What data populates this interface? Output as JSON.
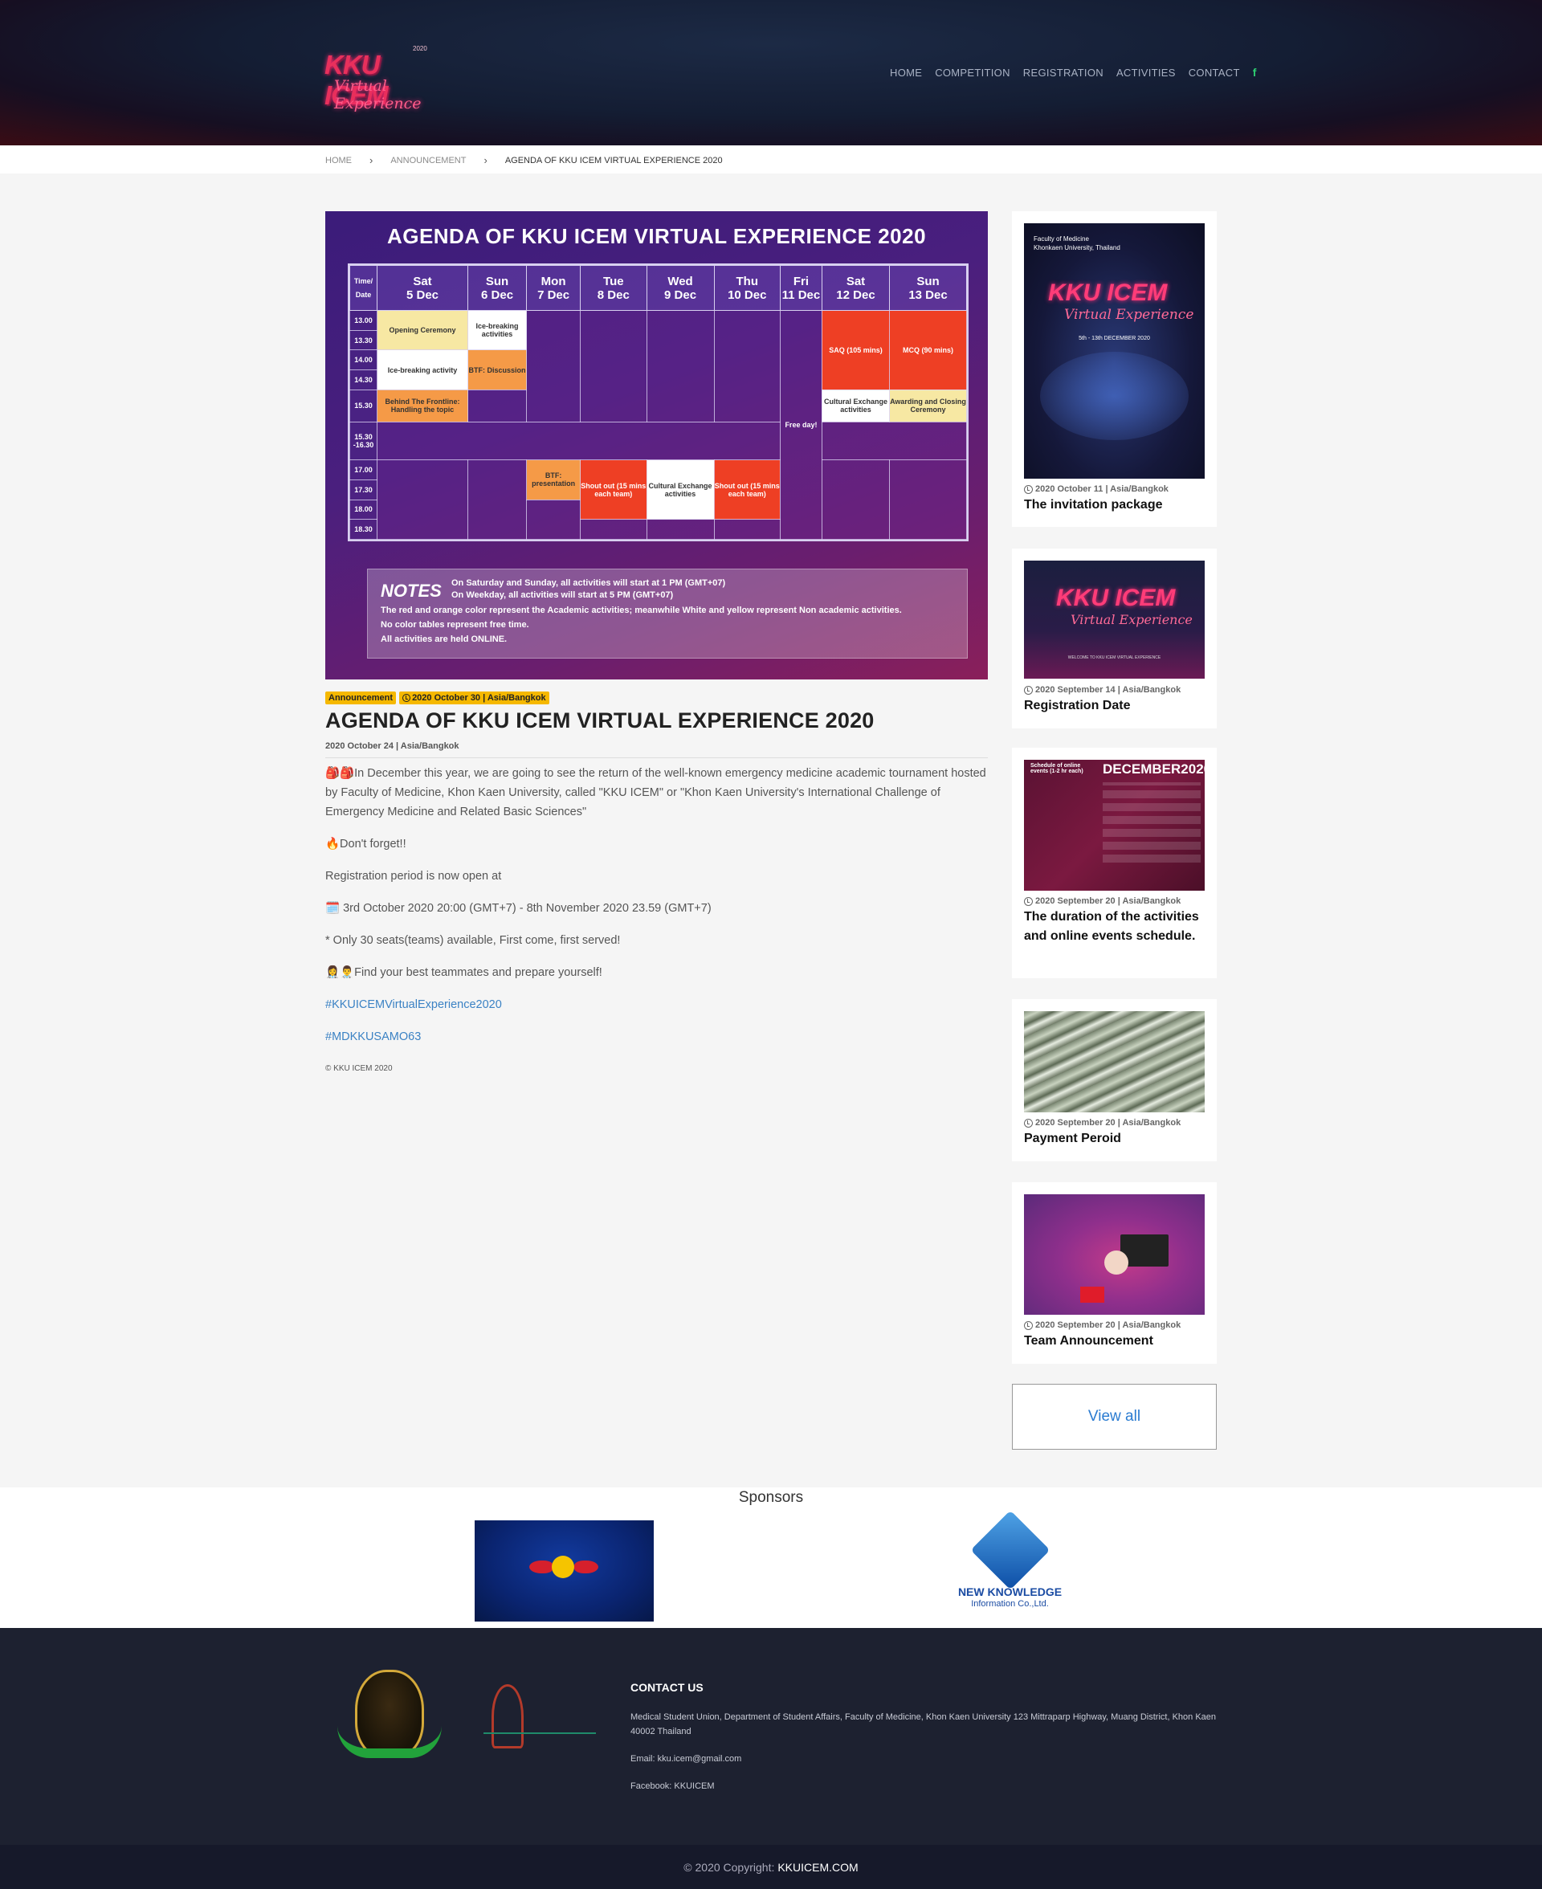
{
  "header": {
    "logo_line1": "KKU ICEM",
    "logo_line2": "Virtual Experience",
    "logo_year": "2020",
    "nav": [
      "HOME",
      "COMPETITION",
      "REGISTRATION",
      "ACTIVITIES",
      "CONTACT"
    ],
    "facebook_glyph": "f"
  },
  "breadcrumb": {
    "items": [
      "HOME",
      "ANNOUNCEMENT",
      "AGENDA OF KKU ICEM VIRTUAL EXPERIENCE 2020"
    ],
    "separator": "›"
  },
  "hero": {
    "title": "AGENDA OF KKU ICEM VIRTUAL EXPERIENCE 2020",
    "time_header": "Time/ Date",
    "days": [
      {
        "day": "Sat",
        "date": "5 Dec"
      },
      {
        "day": "Sun",
        "date": "6 Dec"
      },
      {
        "day": "Mon",
        "date": "7 Dec"
      },
      {
        "day": "Tue",
        "date": "8 Dec"
      },
      {
        "day": "Wed",
        "date": "9 Dec"
      },
      {
        "day": "Thu",
        "date": "10 Dec"
      },
      {
        "day": "Fri",
        "date": "11 Dec"
      },
      {
        "day": "Sat",
        "date": "12 Dec"
      },
      {
        "day": "Sun",
        "date": "13 Dec"
      }
    ],
    "times": [
      "13.00",
      "13.30",
      "14.00",
      "14.30",
      "15.30",
      "15.30 -16.30",
      "17.00",
      "17.30",
      "18.00",
      "18.30"
    ],
    "events": {
      "opening": "Opening Ceremony",
      "icebreak_sun": "Ice-breaking activities",
      "icebreak_sat": "Ice-breaking activity",
      "btf_discussion": "BTF: Discussion",
      "behind": "Behind The Frontline: Handling the topic",
      "free_day": "Free day!",
      "saq": "SAQ (105 mins)",
      "mcq": "MCQ (90 mins)",
      "cultural": "Cultural Exchange activities",
      "awarding": "Awarding and Closing Ceremony",
      "btf_presentation": "BTF: presentation",
      "shout_tue": "Shout out (15 mins each team)",
      "cultural_wed": "Cultural Exchange activities",
      "shout_thu": "Shout out (15 mins each team)"
    },
    "notes_title": "NOTES",
    "notes_top": [
      "On Saturday and Sunday, all activities will start at 1 PM (GMT+07)",
      "On Weekday, all activities will start at 5 PM (GMT+07)"
    ],
    "notes_bottom": [
      "The red and orange color represent the Academic activities; meanwhile White and yellow represent Non academic activities.",
      "No color tables represent free time.",
      "All activities are held ONLINE."
    ]
  },
  "article": {
    "category": "Announcement",
    "tag_date": "2020 October 30 | Asia/Bangkok",
    "title": "AGENDA OF KKU ICEM VIRTUAL EXPERIENCE 2020",
    "date": "2020 October 24 | Asia/Bangkok",
    "paragraphs": [
      "🎒🎒In December this year, we are going to see the return of the well-known emergency medicine academic tournament hosted by Faculty of Medicine, Khon Kaen University, called \"KKU ICEM\" or \"Khon Kaen University's International Challenge of Emergency Medicine and Related Basic Sciences\"",
      "🔥Don't forget!!",
      "Registration period is now open at",
      "🗓️ 3rd October 2020 20:00 (GMT+7) - 8th November 2020 23.59 (GMT+7)",
      "* Only 30 seats(teams) available, First come, first served!",
      "👩‍⚕️👨‍⚕️Find your best teammates and prepare yourself!"
    ],
    "hashtags": [
      "#KKUICEMVirtualExperience2020",
      "#MDKKUSAMO63"
    ],
    "copyright": "© KKU ICEM 2020"
  },
  "sidebar": {
    "cards": [
      {
        "meta": "2020 October 11 | Asia/Bangkok",
        "title": "The invitation package"
      },
      {
        "meta": "2020 September 14 | Asia/Bangkok",
        "title": "Registration Date"
      },
      {
        "meta": "2020 September 20 | Asia/Bangkok",
        "title": "The duration of the activities and online events schedule."
      },
      {
        "meta": "2020 September 20 | Asia/Bangkok",
        "title": "Payment Peroid"
      },
      {
        "meta": "2020 September 20 | Asia/Bangkok",
        "title": "Team Announcement"
      }
    ],
    "view_all": "View all",
    "thumb_texts": {
      "t1_faculty": "Faculty of Medicine",
      "t1_uni": "Khonkaen University, Thailand",
      "t1_dates": "5th - 13th DECEMBER 2020",
      "t2_caption": "WELCOME TO KKU ICEM VIRTUAL EXPERIENCE",
      "t3_heading": "Schedule of online events (1-2 hr each)",
      "t3_month": "DECEMBER2020"
    }
  },
  "sponsors": {
    "title": "Sponsors",
    "redbull_caption": "Redbull",
    "nk_line1": "NEW KNOWLEDGE",
    "nk_line2": "Information Co.,Ltd."
  },
  "footer": {
    "contact_title": "CONTACT US",
    "address": "Medical Student Union, Department of Student Affairs, Faculty of Medicine, Khon Kaen University 123 Mittraparp Highway, Muang District, Khon Kaen 40002 Thailand",
    "email": "Email: kku.icem@gmail.com",
    "facebook": "Facebook: KKUICEM",
    "copyright_prefix": "© 2020 Copyright:",
    "copyright_site": "KKUICEM.COM"
  },
  "colors": {
    "accent_yellow": "#f5b800",
    "link_blue": "#3b82c4",
    "academic_red": "#ee3f24",
    "academic_orange": "#f59a47",
    "nonacademic_yellow": "#f7e8a3"
  }
}
